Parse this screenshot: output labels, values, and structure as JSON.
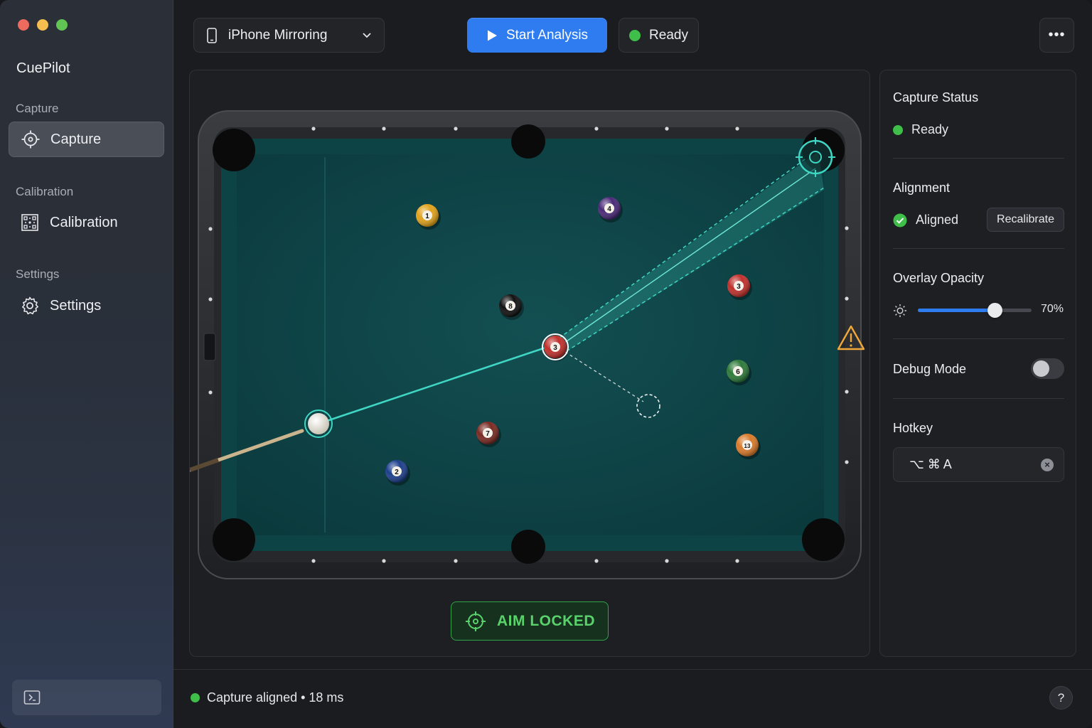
{
  "app": {
    "title": "CuePilot"
  },
  "sidebar": {
    "sections": [
      {
        "label": "Capture",
        "item": {
          "label": "Capture",
          "icon": "crosshair-icon",
          "active": true
        }
      },
      {
        "label": "Calibration",
        "item": {
          "label": "Calibration",
          "icon": "calibration-grid-icon",
          "active": false
        }
      },
      {
        "label": "Settings",
        "item": {
          "label": "Settings",
          "icon": "gear-icon",
          "active": false
        }
      }
    ]
  },
  "toolbar": {
    "device": "iPhone Mirroring",
    "start_label": "Start Analysis",
    "status_label": "Ready",
    "more_label": "•••"
  },
  "canvas": {
    "aim_label": "AIM LOCKED",
    "balls": [
      {
        "number": "1",
        "color": "#e0a21b"
      },
      {
        "number": "4",
        "color": "#4a2a78"
      },
      {
        "number": "8",
        "color": "#111111"
      },
      {
        "number": "3",
        "color": "#c0302c"
      },
      {
        "number": "3",
        "color": "#c0302c"
      },
      {
        "number": "6",
        "color": "#2e7a3a"
      },
      {
        "number": "7",
        "color": "#7a2a22"
      },
      {
        "number": "2",
        "color": "#1e3f8c"
      },
      {
        "number": "13",
        "color": "#d97a2a"
      }
    ],
    "warning_icon": "warning-icon"
  },
  "right_panel": {
    "capture_status": {
      "title": "Capture Status",
      "value": "Ready"
    },
    "alignment": {
      "title": "Alignment",
      "value": "Aligned",
      "button": "Recalibrate"
    },
    "overlay_opacity": {
      "title": "Overlay Opacity",
      "value_label": "70%",
      "value": 0.7
    },
    "debug_mode": {
      "title": "Debug Mode",
      "enabled": false
    },
    "hotkey": {
      "title": "Hotkey",
      "value": "⌥ ⌘ A"
    }
  },
  "statusbar": {
    "text": "Capture aligned • 18 ms",
    "help": "?"
  },
  "colors": {
    "accent": "#2f7bf0",
    "success": "#3fbf4a",
    "aim": "#3fd6c4",
    "felt": "#0f4a4c"
  }
}
